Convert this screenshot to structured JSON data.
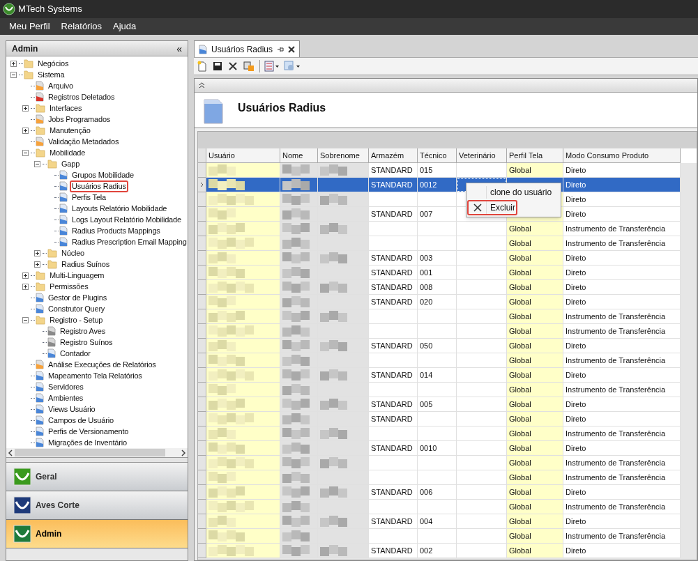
{
  "window": {
    "title": "MTech Systems"
  },
  "menu": [
    "Meu Perfil",
    "Relatórios",
    "Ajuda"
  ],
  "sidebar": {
    "title": "Admin",
    "collapse": "«",
    "tree": [
      {
        "label": "Negócios",
        "kind": "folder",
        "expanded": false,
        "outlined": false
      },
      {
        "label": "Sistema",
        "kind": "folder",
        "expanded": true,
        "outlined": false,
        "children": [
          {
            "label": "Arquivo",
            "kind": "report",
            "outlined": false
          },
          {
            "label": "Registros Deletados",
            "kind": "deleted",
            "outlined": false
          },
          {
            "label": "Interfaces",
            "kind": "folder",
            "expanded": false,
            "outlined": false
          },
          {
            "label": "Jobs Programados",
            "kind": "report",
            "outlined": false
          },
          {
            "label": "Manutenção",
            "kind": "folder",
            "expanded": false,
            "outlined": false
          },
          {
            "label": "Validação Metadados",
            "kind": "report",
            "outlined": false
          },
          {
            "label": "Mobilidade",
            "kind": "folder",
            "expanded": true,
            "outlined": false,
            "children": [
              {
                "label": "Gapp",
                "kind": "folder",
                "expanded": true,
                "outlined": false,
                "children": [
                  {
                    "label": "Grupos Mobilidade",
                    "kind": "form",
                    "outlined": false
                  },
                  {
                    "label": "Usuários Radius",
                    "kind": "form",
                    "outlined": true
                  },
                  {
                    "label": "Perfis Tela",
                    "kind": "form",
                    "outlined": false
                  },
                  {
                    "label": "Layouts Relatório Mobilidade",
                    "kind": "form",
                    "outlined": false
                  },
                  {
                    "label": "Logs Layout Relatório Mobilidade",
                    "kind": "form",
                    "outlined": false
                  },
                  {
                    "label": "Radius Products Mappings",
                    "kind": "form",
                    "outlined": false
                  },
                  {
                    "label": "Radius Prescription Email Mapping",
                    "kind": "form",
                    "outlined": false
                  }
                ]
              },
              {
                "label": "Núcleo",
                "kind": "folder",
                "expanded": false,
                "outlined": false
              },
              {
                "label": "Radius Suínos",
                "kind": "folder",
                "expanded": false,
                "outlined": false
              }
            ]
          },
          {
            "label": "Multi-Linguagem",
            "kind": "folder",
            "expanded": false,
            "outlined": false
          },
          {
            "label": "Permissões",
            "kind": "folder",
            "expanded": false,
            "outlined": false
          },
          {
            "label": "Gestor de Plugins",
            "kind": "form",
            "outlined": false
          },
          {
            "label": "Construtor Query",
            "kind": "form",
            "outlined": false
          },
          {
            "label": "Registro - Setup",
            "kind": "folder",
            "expanded": true,
            "outlined": false,
            "children": [
              {
                "label": "Registro Aves",
                "kind": "registry",
                "outlined": false
              },
              {
                "label": "Registro Suínos",
                "kind": "registry",
                "outlined": false
              },
              {
                "label": "Contador",
                "kind": "form",
                "outlined": false
              }
            ]
          },
          {
            "label": "Análise Execuções de Relatórios",
            "kind": "report",
            "outlined": false
          },
          {
            "label": "Mapeamento Tela Relatórios",
            "kind": "form",
            "outlined": false
          },
          {
            "label": "Servidores",
            "kind": "form",
            "outlined": false
          },
          {
            "label": "Ambientes",
            "kind": "form",
            "outlined": false
          },
          {
            "label": "Views Usuário",
            "kind": "form",
            "outlined": false
          },
          {
            "label": "Campos de Usuário",
            "kind": "form",
            "outlined": false
          },
          {
            "label": "Perfis de Versionamento",
            "kind": "form",
            "outlined": false
          },
          {
            "label": "Migrações de Inventário",
            "kind": "form",
            "outlined": false
          }
        ]
      }
    ],
    "modules": [
      {
        "label": "Geral",
        "color": "#3a9a1e",
        "selected": false
      },
      {
        "label": "Aves Corte",
        "color": "#1e3a7a",
        "selected": false
      },
      {
        "label": "Admin",
        "color": "#1e7a3a",
        "selected": true
      }
    ]
  },
  "tab": {
    "label": "Usuários Radius"
  },
  "page": {
    "title": "Usuários Radius"
  },
  "table": {
    "columns": [
      "Usuário",
      "Nome",
      "Sobrenome",
      "Armazém",
      "Técnico",
      "Veterinário",
      "Perfil Tela",
      "Modo Consumo Produto"
    ],
    "rows": [
      {
        "selected": false,
        "armazem": "STANDARD",
        "tecnico": "015",
        "perfil": "Global",
        "modo": "Direto"
      },
      {
        "selected": true,
        "armazem": "STANDARD",
        "tecnico": "0012",
        "modo": "Direto"
      },
      {
        "selected": false,
        "modo": "Direto"
      },
      {
        "selected": false,
        "armazem": "STANDARD",
        "tecnico": "007",
        "modo": "Direto"
      },
      {
        "selected": false,
        "perfil": "Global",
        "modo": "Instrumento de Transferência"
      },
      {
        "selected": false,
        "perfil": "Global",
        "modo": "Instrumento de Transferência"
      },
      {
        "selected": false,
        "armazem": "STANDARD",
        "tecnico": "003",
        "perfil": "Global",
        "modo": "Direto"
      },
      {
        "selected": false,
        "armazem": "STANDARD",
        "tecnico": "001",
        "perfil": "Global",
        "modo": "Direto"
      },
      {
        "selected": false,
        "armazem": "STANDARD",
        "tecnico": "008",
        "perfil": "Global",
        "modo": "Direto"
      },
      {
        "selected": false,
        "armazem": "STANDARD",
        "tecnico": "020",
        "perfil": "Global",
        "modo": "Direto"
      },
      {
        "selected": false,
        "perfil": "Global",
        "modo": "Instrumento de Transferência"
      },
      {
        "selected": false,
        "perfil": "Global",
        "modo": "Instrumento de Transferência"
      },
      {
        "selected": false,
        "armazem": "STANDARD",
        "tecnico": "050",
        "perfil": "Global",
        "modo": "Direto"
      },
      {
        "selected": false,
        "perfil": "Global",
        "modo": "Instrumento de Transferência"
      },
      {
        "selected": false,
        "armazem": "STANDARD",
        "tecnico": "014",
        "perfil": "Global",
        "modo": "Direto"
      },
      {
        "selected": false,
        "perfil": "Global",
        "modo": "Instrumento de Transferência"
      },
      {
        "selected": false,
        "armazem": "STANDARD",
        "tecnico": "005",
        "perfil": "Global",
        "modo": "Direto"
      },
      {
        "selected": false,
        "armazem": "STANDARD",
        "perfil": "Global",
        "modo": "Direto"
      },
      {
        "selected": false,
        "perfil": "Global",
        "modo": "Instrumento de Transferência"
      },
      {
        "selected": false,
        "armazem": "STANDARD",
        "tecnico": "0010",
        "perfil": "Global",
        "modo": "Direto"
      },
      {
        "selected": false,
        "perfil": "Global",
        "modo": "Instrumento de Transferência"
      },
      {
        "selected": false,
        "perfil": "Global",
        "modo": "Instrumento de Transferência"
      },
      {
        "selected": false,
        "armazem": "STANDARD",
        "tecnico": "006",
        "perfil": "Global",
        "modo": "Direto"
      },
      {
        "selected": false,
        "perfil": "Global",
        "modo": "Instrumento de Transferência"
      },
      {
        "selected": false,
        "armazem": "STANDARD",
        "tecnico": "004",
        "perfil": "Global",
        "modo": "Direto"
      },
      {
        "selected": false,
        "perfil": "Global",
        "modo": "Instrumento de Transferência"
      },
      {
        "selected": false,
        "armazem": "STANDARD",
        "tecnico": "002",
        "perfil": "Global",
        "modo": "Direto"
      }
    ]
  },
  "context_menu": [
    {
      "label": "clone do usuário",
      "kind": "plain",
      "outlined": false
    },
    {
      "label": "Excluir",
      "kind": "delete",
      "outlined": true
    }
  ]
}
